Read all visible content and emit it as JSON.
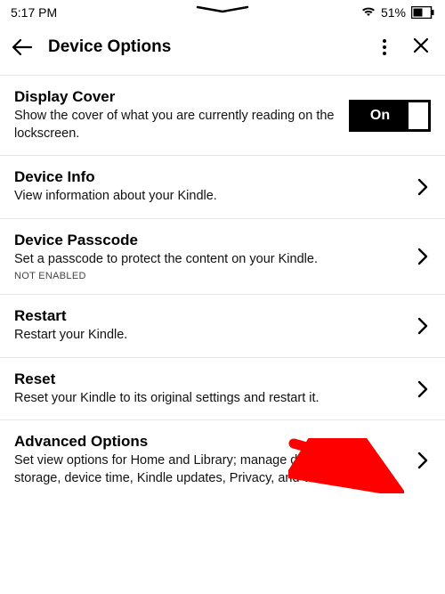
{
  "statusbar": {
    "time": "5:17 PM",
    "battery_text": "51%"
  },
  "header": {
    "title": "Device Options"
  },
  "items": {
    "display_cover": {
      "title": "Display Cover",
      "desc": "Show the cover of what you are currently reading on the lockscreen.",
      "toggle_label": "On"
    },
    "device_info": {
      "title": "Device Info",
      "desc": "View information about your Kindle."
    },
    "device_passcode": {
      "title": "Device Passcode",
      "desc": "Set a passcode to protect the content on your Kindle.",
      "status": "NOT ENABLED"
    },
    "restart": {
      "title": "Restart",
      "desc": "Restart your Kindle."
    },
    "reset": {
      "title": "Reset",
      "desc": "Reset your Kindle to its original settings and restart it."
    },
    "advanced": {
      "title": "Advanced Options",
      "desc": "Set view options for Home and Library; manage device power, storage, device time, Kindle updates, Privacy, and Whispersync."
    }
  }
}
